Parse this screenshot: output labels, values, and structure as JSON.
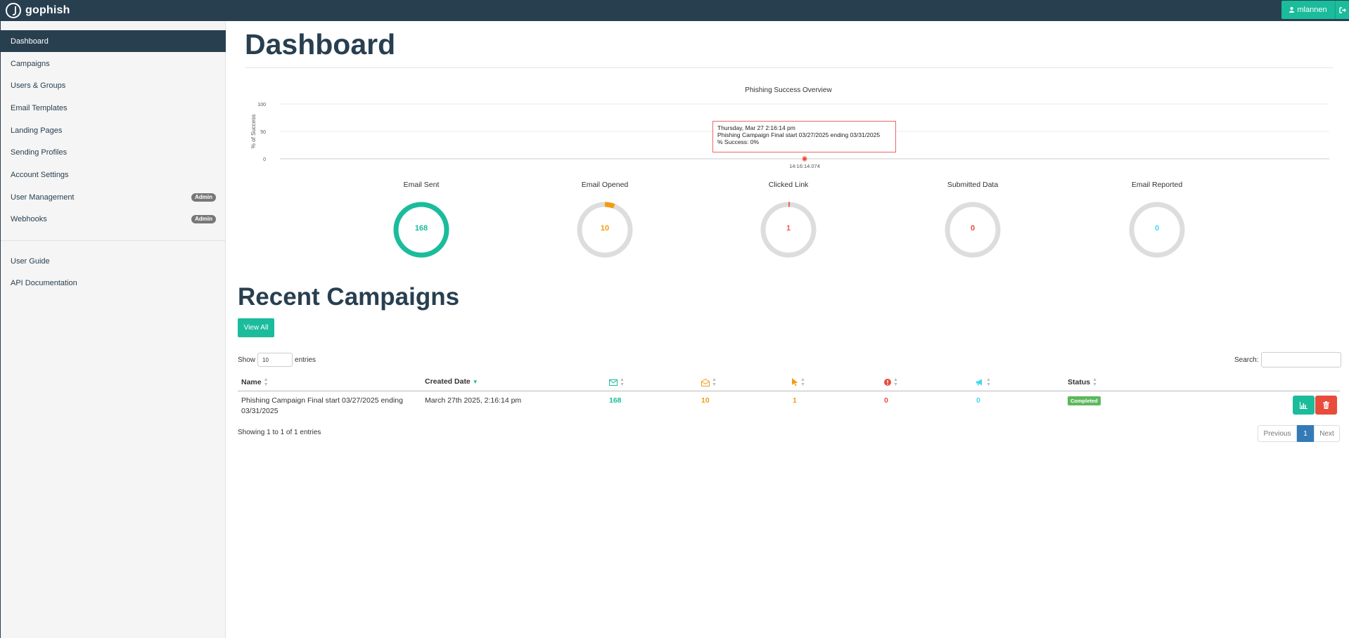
{
  "app": {
    "brand": "gophish"
  },
  "header": {
    "user_label": "mlannen"
  },
  "sidebar": {
    "items": [
      {
        "label": "Dashboard"
      },
      {
        "label": "Campaigns"
      },
      {
        "label": "Users & Groups"
      },
      {
        "label": "Email Templates"
      },
      {
        "label": "Landing Pages"
      },
      {
        "label": "Sending Profiles"
      },
      {
        "label": "Account Settings"
      },
      {
        "label": "User Management",
        "badge": "Admin"
      },
      {
        "label": "Webhooks",
        "badge": "Admin"
      }
    ],
    "links": [
      {
        "label": "User Guide"
      },
      {
        "label": "API Documentation"
      }
    ]
  },
  "page": {
    "title": "Dashboard"
  },
  "chart_data": {
    "type": "line",
    "title": "Phishing Success Overview",
    "ylabel": "% of Success",
    "yticks": [
      "100",
      "50",
      "0"
    ],
    "ylim": [
      0,
      100
    ],
    "x": [
      "14:16:14.074"
    ],
    "series": [
      {
        "values": [
          0
        ]
      }
    ],
    "grid": true
  },
  "tooltip": {
    "line1": "Thursday, Mar 27 2:16:14 pm",
    "line2": "Phishing Campaign Final start 03/27/2025 ending 03/31/2025",
    "line3": "% Success: 0%"
  },
  "stats": [
    {
      "label": "Email Sent",
      "value": "168",
      "fraction": 1.0,
      "color": "#1abc9c"
    },
    {
      "label": "Email Opened",
      "value": "10",
      "fraction": 0.0595,
      "color": "#f39c12"
    },
    {
      "label": "Clicked Link",
      "value": "1",
      "fraction": 0.006,
      "color": "#f05b4f"
    },
    {
      "label": "Submitted Data",
      "value": "0",
      "fraction": 0,
      "color": "#e74c3c"
    },
    {
      "label": "Email Reported",
      "value": "0",
      "fraction": 0,
      "color": "#45d6ef"
    }
  ],
  "recent": {
    "title": "Recent Campaigns",
    "view_all": "View All",
    "show_label": "Show",
    "show_value": "10",
    "entries_label": "entries",
    "search_label": "Search:",
    "columns": {
      "name": "Name",
      "created": "Created Date",
      "status": "Status"
    },
    "rows": [
      {
        "name": "Phishing Campaign Final start 03/27/2025 ending 03/31/2025",
        "created": "March 27th 2025, 2:16:14 pm",
        "sent": "168",
        "opened": "10",
        "clicked": "1",
        "submitted": "0",
        "reported": "0",
        "status": "Completed"
      }
    ],
    "info": "Showing 1 to 1 of 1 entries",
    "pagination": {
      "prev": "Previous",
      "current": "1",
      "next": "Next"
    }
  },
  "colors": {
    "navy": "#283f50",
    "teal": "#1abc9c",
    "orange": "#f39c12",
    "red": "#e74c3c",
    "cyan": "#45d6ef",
    "status_green": "#5cb85c",
    "pager_blue": "#337ab7"
  }
}
